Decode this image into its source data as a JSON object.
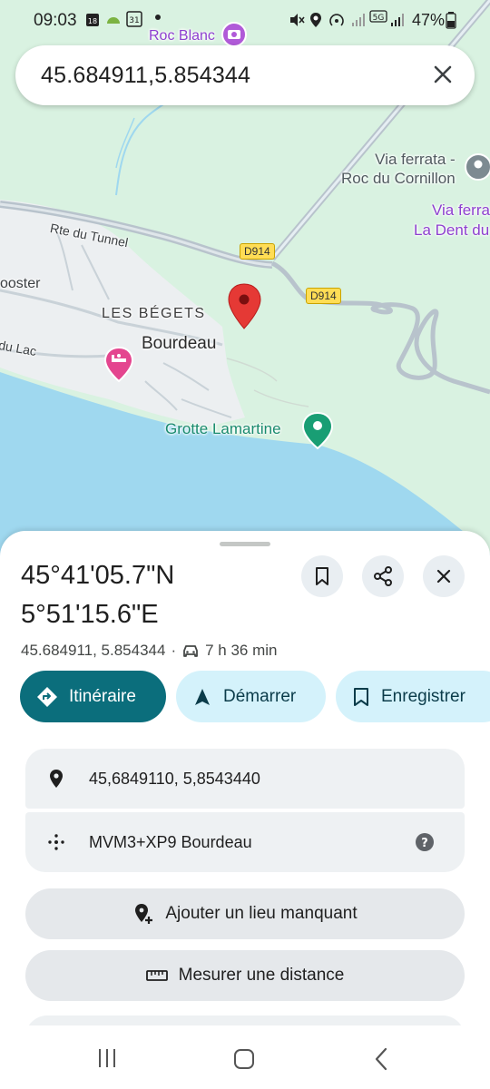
{
  "status_bar": {
    "time": "09:03",
    "calendar_day_1": "18",
    "calendar_day_2": "31",
    "battery": "47%"
  },
  "search": {
    "value": "45.684911,5.854344"
  },
  "map": {
    "labels": {
      "roc_blanc": "Roc Blanc",
      "via_ferrata_1_line1": "Via ferrata -",
      "via_ferrata_1_line2": "Roc du Cornillon",
      "via_ferrata_2_line1": "Via ferra",
      "via_ferrata_2_line2": "La Dent du",
      "rte_tunnel": "Rte du Tunnel",
      "d914_a": "D914",
      "d914_b": "D914",
      "booster": "ooster",
      "du_lac": "du Lac",
      "les_begets": "LES BÉGETS",
      "bourdeau": "Bourdeau",
      "grotte": "Grotte Lamartine"
    },
    "colors": {
      "land": "#d9f2e1",
      "water": "#9fd8ef",
      "urban": "#eceff1",
      "road": "#b8c3cc",
      "pin": "#e53935"
    }
  },
  "sheet": {
    "coord_line1": "45°41'05.7\"N",
    "coord_line2": "5°51'15.6\"E",
    "decimal_coords": "45.684911, 5.854344",
    "separator": "·",
    "drive_time": "7 h 36 min",
    "buttons": {
      "itineraire": "Itinéraire",
      "demarrer": "Démarrer",
      "enregistrer": "Enregistrer"
    },
    "rows": {
      "coords": "45,6849110, 5,8543440",
      "plus_code": "MVM3+XP9 Bourdeau"
    },
    "actions": {
      "add_place": "Ajouter un lieu manquant",
      "measure": "Mesurer une distance"
    }
  },
  "colors": {
    "primary": "#0b6e7c",
    "tonal": "#d4f2fb"
  }
}
